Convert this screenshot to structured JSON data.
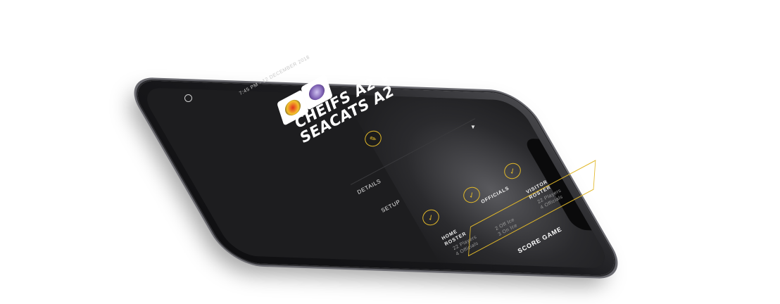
{
  "game": {
    "datetime": "7:45 PM - 12 DECEMBER 2018",
    "title": "CHEIFS A2 VS\nSEACATS A2"
  },
  "tabs": {
    "details": "DETAILS",
    "setup": "SETUP"
  },
  "cards": [
    {
      "label": "HOME\nROSTER",
      "sub": "22 Players\n4 Officials"
    },
    {
      "label": "OFFICIALS",
      "sub": "2 Off Ice\n3 On Ice"
    },
    {
      "label": "VISITOR\nROSTER",
      "sub": "22 Players\n4 Officials"
    }
  ],
  "actions": {
    "score_game": "SCORE GAME"
  },
  "icons": {
    "clock": "clock-icon",
    "switch": "switch-icon",
    "edit": "pencil-icon",
    "check": "check-icon",
    "dropdown": "triangle-down-icon"
  },
  "colors": {
    "accent": "#e1b82a",
    "background": "#1d1d1f",
    "text": "#ffffff"
  }
}
